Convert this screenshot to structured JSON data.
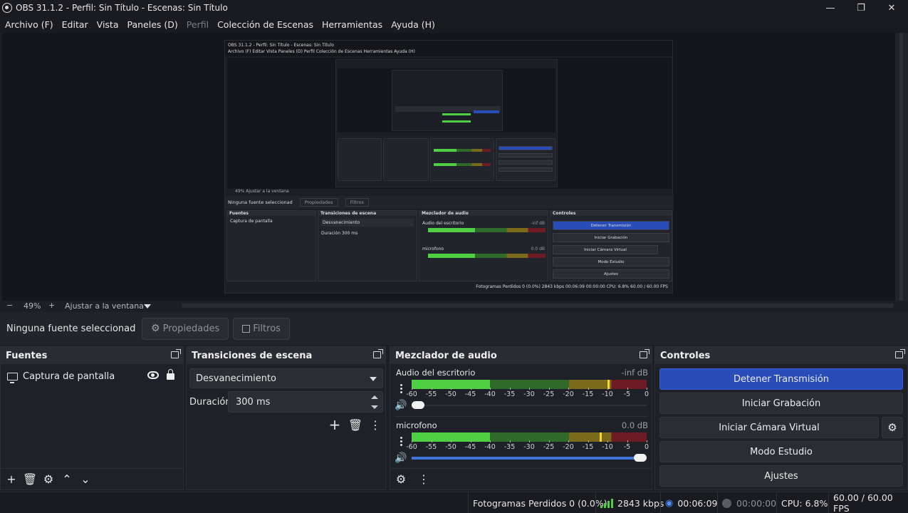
{
  "window": {
    "title": "OBS 31.1.2 - Perfil: Sin Título - Escenas: Sin Título",
    "minimize": "—",
    "maximize": "❐",
    "close": "✕"
  },
  "menu": [
    {
      "label": "Archivo (F)",
      "disabled": false
    },
    {
      "label": "Editar",
      "disabled": false
    },
    {
      "label": "Vista",
      "disabled": false
    },
    {
      "label": "Paneles (D)",
      "disabled": false
    },
    {
      "label": "Perfil",
      "disabled": true
    },
    {
      "label": "Colección de Escenas",
      "disabled": false
    },
    {
      "label": "Herramientas",
      "disabled": false
    },
    {
      "label": "Ayuda (H)",
      "disabled": false
    }
  ],
  "zoom": {
    "minus": "−",
    "value": "49%",
    "plus": "+",
    "fit_label": "Ajustar a la ventana"
  },
  "properties_bar": {
    "no_source": "Ninguna fuente seleccionad",
    "properties": "Propiedades",
    "filters": "Filtros"
  },
  "sources": {
    "title": "Fuentes",
    "items": [
      {
        "name": "Captura de pantalla",
        "visible": true,
        "locked": true
      }
    ]
  },
  "transitions": {
    "title": "Transiciones de escena",
    "selected": "Desvanecimiento",
    "duration_label": "Duración",
    "duration_value": "300 ms"
  },
  "mixer": {
    "title": "Mezclador de audio",
    "scale": [
      "-60",
      "-55",
      "-50",
      "-45",
      "-40",
      "-35",
      "-30",
      "-25",
      "-20",
      "-15",
      "-10",
      "-5",
      "0"
    ],
    "tracks": [
      {
        "name": "Audio del escritorio",
        "db": "-inf dB",
        "level_db": -10,
        "volume": 0.0
      },
      {
        "name": "microfono",
        "db": "0.0 dB",
        "level_db": -12,
        "volume": 1.0
      }
    ]
  },
  "controls": {
    "title": "Controles",
    "stop_stream": "Detener Transmisión",
    "start_recording": "Iniciar Grabación",
    "virtual_camera": "Iniciar Cámara Virtual",
    "studio_mode": "Modo Estudio",
    "settings": "Ajustes"
  },
  "status": {
    "dropped": "Fotogramas Perdidos 0 (0.0%)",
    "bitrate": "2843 kbps",
    "stream_time": "00:06:09",
    "rec_time": "00:00:00",
    "cpu": "CPU: 6.8%",
    "fps": "60.00 / 60.00 FPS"
  },
  "nested": {
    "title": "OBS 31.1.2 - Perfil: Sin Título - Escenas: Sin Título",
    "menu": "Archivo (F)   Editar   Vista   Paneles (D)   Perfil   Colección de Escenas   Herramientas   Ayuda (H)",
    "zoom": "49%    Ajustar a la ventana",
    "no_source": "Ninguna fuente seleccionad",
    "properties": "Propiedades",
    "filters": "Filtros",
    "sources_title": "Fuentes",
    "source_item": "Captura de pantalla",
    "transitions_title": "Transiciones de escena",
    "transition": "Desvanecimiento",
    "duration": "Duración    300 ms",
    "mixer_title": "Mezclador de audio",
    "track1": "Audio del escritorio",
    "track1_db": "-inf dB",
    "track2": "microfono",
    "track2_db": "0.0 dB",
    "controls_title": "Controles",
    "stop": "Detener Transmisión",
    "rec": "Iniciar Grabación",
    "vcam": "Iniciar Cámara Virtual",
    "studio": "Modo Estudio",
    "settings": "Ajustes",
    "status": "Fotogramas Perdidos 0 (0.0%)   2843 kbps   00:06:09   00:00:00   CPU: 6.8%   60.00 / 60.00 FPS"
  }
}
